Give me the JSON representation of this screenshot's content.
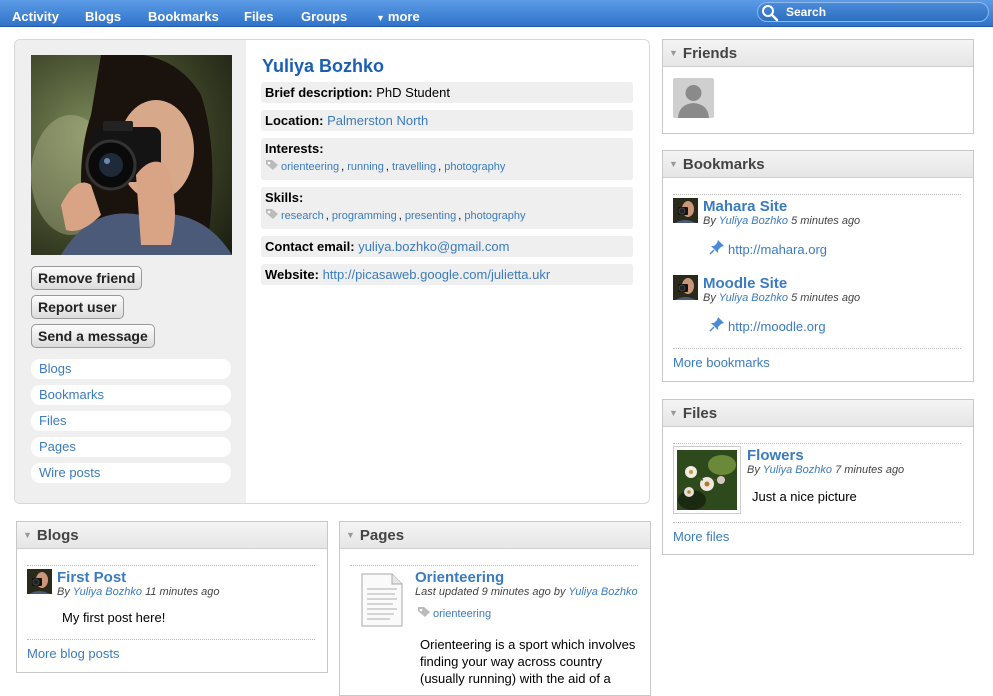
{
  "nav": {
    "items": [
      "Activity",
      "Blogs",
      "Bookmarks",
      "Files",
      "Groups"
    ],
    "more": "more",
    "search_placeholder": "Search"
  },
  "profile": {
    "name": "Yuliya Bozhko",
    "buttons": [
      "Remove friend",
      "Report user",
      "Send a message"
    ],
    "sidelinks": [
      "Blogs",
      "Bookmarks",
      "Files",
      "Pages",
      "Wire posts"
    ],
    "brief_label": "Brief description:",
    "brief_value": "PhD Student",
    "location_label": "Location:",
    "location_value": "Palmerston North",
    "interests_label": "Interests:",
    "interests": [
      "orienteering",
      "running",
      "travelling",
      "photography"
    ],
    "skills_label": "Skills:",
    "skills": [
      "research",
      "programming",
      "presenting",
      "photography"
    ],
    "email_label": "Contact email:",
    "email_value": "yuliya.bozhko@gmail.com",
    "website_label": "Website:",
    "website_value": "http://picasaweb.google.com/julietta.ukr"
  },
  "friends": {
    "title": "Friends"
  },
  "bookmarks": {
    "title": "Bookmarks",
    "items": [
      {
        "title": "Mahara Site",
        "by": "By",
        "author": "Yuliya Bozhko",
        "time": "5 minutes ago",
        "url": "http://mahara.org"
      },
      {
        "title": "Moodle Site",
        "by": "By",
        "author": "Yuliya Bozhko",
        "time": "5 minutes ago",
        "url": "http://moodle.org"
      }
    ],
    "more": "More bookmarks"
  },
  "files": {
    "title": "Files",
    "item": {
      "title": "Flowers",
      "by": "By",
      "author": "Yuliya Bozhko",
      "time": "7 minutes ago",
      "desc": "Just a nice picture"
    },
    "more": "More files"
  },
  "blogs": {
    "title": "Blogs",
    "item": {
      "title": "First Post",
      "by": "By",
      "author": "Yuliya Bozhko",
      "time": "11 minutes ago",
      "body": "My first post here!"
    },
    "more": "More blog posts"
  },
  "pages": {
    "title": "Pages",
    "item": {
      "title": "Orienteering",
      "updated": "Last updated 9 minutes ago by",
      "author": "Yuliya Bozhko",
      "tag": "orienteering",
      "body_lines": [
        "Orienteering is a sport which involves",
        "finding your way across country",
        "(usually running) with the aid of a"
      ]
    }
  }
}
